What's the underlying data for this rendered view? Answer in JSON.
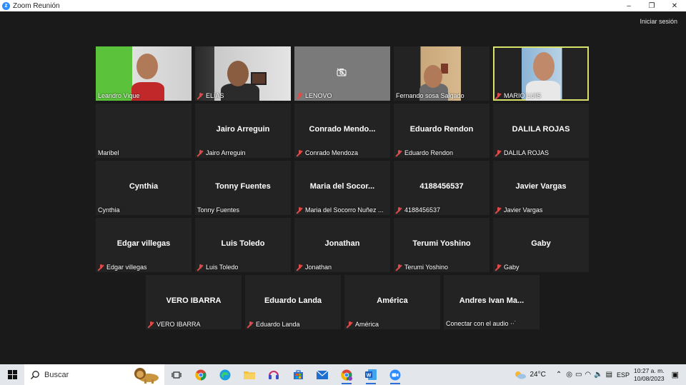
{
  "window": {
    "title": "Zoom Reunión",
    "minimize": "–",
    "restore": "❐",
    "close": "✕"
  },
  "header": {
    "signin": "Iniciar sesión"
  },
  "participants": [
    {
      "name": "Leandro Vique",
      "muted": false,
      "video": true
    },
    {
      "name": "ELÍAS",
      "muted": true,
      "video": true
    },
    {
      "name": "LENOVO",
      "muted": true,
      "video": false
    },
    {
      "name": "Fernando sosa Salgado",
      "muted": false,
      "video": true
    },
    {
      "name": "MARIO LUIS",
      "muted": true,
      "video": true,
      "active_speaker": true
    },
    {
      "display": "",
      "name": "Maribel",
      "muted": false
    },
    {
      "display": "Jairo Arreguin",
      "name": "Jairo Arreguin",
      "muted": true
    },
    {
      "display": "Conrado  Mendo...",
      "name": "Conrado Mendoza",
      "muted": true
    },
    {
      "display": "Eduardo Rendon",
      "name": "Eduardo Rendon",
      "muted": true
    },
    {
      "display": "DALILA ROJAS",
      "name": "DALILA ROJAS",
      "muted": true
    },
    {
      "display": "Cynthia",
      "name": "Cynthia",
      "muted": false
    },
    {
      "display": "Tonny Fuentes",
      "name": "Tonny Fuentes",
      "muted": false
    },
    {
      "display": "Maria  del  Socor...",
      "name": "Maria del Socorro Nuñez ...",
      "muted": true
    },
    {
      "display": "4188456537",
      "name": "4188456537",
      "muted": true
    },
    {
      "display": "Javier Vargas",
      "name": "Javier Vargas",
      "muted": true
    },
    {
      "display": "Edgar villegas",
      "name": "Edgar villegas",
      "muted": true
    },
    {
      "display": "Luis Toledo",
      "name": "Luis Toledo",
      "muted": true
    },
    {
      "display": "Jonathan",
      "name": "Jonathan",
      "muted": true
    },
    {
      "display": "Terumi Yoshino",
      "name": "Terumi Yoshino",
      "muted": true
    },
    {
      "display": "Gaby",
      "name": "Gaby",
      "muted": true
    },
    {
      "display": "VERO IBARRA",
      "name": "VERO IBARRA",
      "muted": true
    },
    {
      "display": "Eduardo Landa",
      "name": "Eduardo Landa",
      "muted": true
    },
    {
      "display": "América",
      "name": "América",
      "muted": true
    },
    {
      "display": "Andres  Ivan  Ma...",
      "name": "Conectar con el audio ⋅⋅˙",
      "muted": false
    }
  ],
  "taskbar": {
    "search_label": "Buscar",
    "weather": "24°C",
    "language": "ESP",
    "time": "10:27 a. m.",
    "date": "10/08/2023"
  },
  "colors": {
    "active_speaker": "#d8e26b",
    "muted_mic": "#e24a4a",
    "zoom_blue": "#2d8cff"
  }
}
